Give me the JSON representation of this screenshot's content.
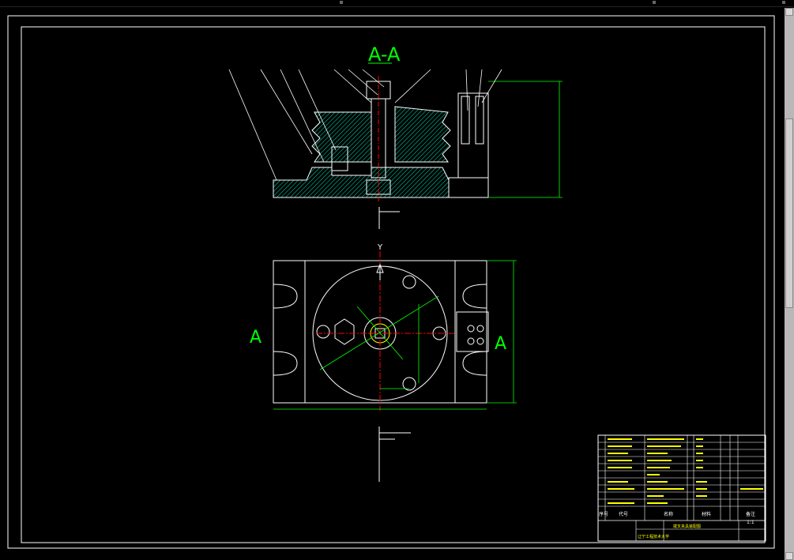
{
  "section_label": "A-A",
  "view_label_left": "A",
  "view_label_right": "A",
  "axis_y_label": "Y",
  "title_block": {
    "header_code": "代号",
    "header_name": "名称",
    "header_material": "材料",
    "header_note": "备注",
    "header_row": "序号",
    "drawing_title": "拨叉夹具装配图",
    "scale": "1:1",
    "school": "辽宁工程技术大学"
  },
  "colors": {
    "background": "#000000",
    "outline": "#ffffff",
    "section": "#00ff00",
    "hatch": "#00c8a0",
    "dimension": "#00ff00",
    "centerline": "#ff0000",
    "leader": "#ffffff"
  }
}
